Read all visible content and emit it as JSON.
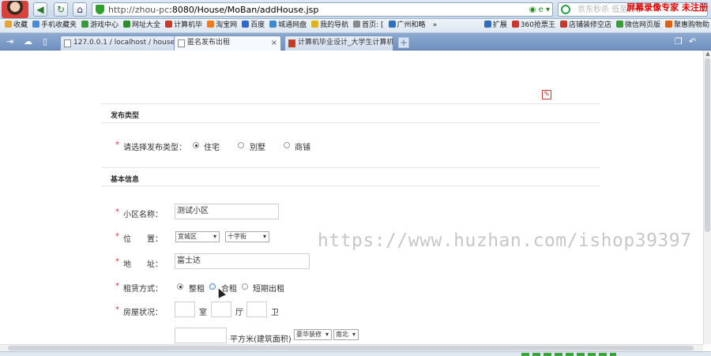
{
  "browser": {
    "address": {
      "host": "http://zhou-pc",
      "path": ":8080/House/MoBan/addHouse.jsp"
    },
    "address_icons": "◉ e ▾",
    "search_placeholder": "京东秒杀 低至1元",
    "screen_recorder": "屏幕录像专家 未注册",
    "bookmarks": [
      {
        "label": "收藏",
        "color": "#e8a33a"
      },
      {
        "label": "手机收藏夹",
        "color": "#4a8ad4"
      },
      {
        "label": "游戏中心",
        "color": "#3a9b3a"
      },
      {
        "label": "网址大全",
        "color": "#2e8b2e"
      },
      {
        "label": "计算机毕",
        "color": "#c8382c"
      },
      {
        "label": "淘宝网",
        "color": "#f07a1e"
      },
      {
        "label": "百度",
        "color": "#3366cc"
      },
      {
        "label": "城通网盘",
        "color": "#3a8ad4"
      },
      {
        "label": "我的导航",
        "color": "#e0b020"
      },
      {
        "label": "首页: [",
        "color": "#888888"
      },
      {
        "label": "广州和略",
        "color": "#2f6fbf"
      }
    ],
    "bookmarks_more": "»",
    "bookmarks_right": [
      {
        "label": "扩展",
        "color": "#2f6fbf"
      },
      {
        "label": "360抢票王",
        "color": "#c8382c"
      },
      {
        "label": "店铺装修空店",
        "color": "#c8382c"
      },
      {
        "label": "微信网页版",
        "color": "#3a9b3a"
      },
      {
        "label": "聚惠购物助",
        "color": "#e06010"
      }
    ],
    "tabs": [
      {
        "label": "127.0.0.1 / localhost / house",
        "active": false
      },
      {
        "label": "匿名发布出租",
        "active": true
      },
      {
        "label": "计算机毕业设计_大学生计算机",
        "active": false
      }
    ],
    "tab_close": "×",
    "tab_add": "+"
  },
  "form": {
    "section_publish_type": "发布类型",
    "publish_type": {
      "label": "请选择发布类型：",
      "options": [
        "住宅",
        "别墅",
        "商铺"
      ],
      "selected": 0
    },
    "section_basic": "基本信息",
    "community": {
      "label": "小区名称：",
      "value": "测试小区"
    },
    "location": {
      "label": "位　　置：",
      "district": "宜城区",
      "street": "十字街"
    },
    "address": {
      "label": "地　　址：",
      "value": "富士达"
    },
    "rent_type": {
      "label": "租赁方式：",
      "options": [
        "整租",
        "合租",
        "短期出租"
      ],
      "selected": 0
    },
    "house_status": {
      "label": "房屋状况：",
      "room_unit": "室",
      "hall_unit": "厅",
      "bath_unit": "卫",
      "room": "",
      "hall": "",
      "bath": ""
    },
    "area": {
      "value": "",
      "unit": "平方米(建筑面积)",
      "decoration": "豪华装修",
      "orientation": "南北"
    }
  },
  "watermark": "https://www.huzhan.com/ishop39397",
  "required_mark": "*"
}
